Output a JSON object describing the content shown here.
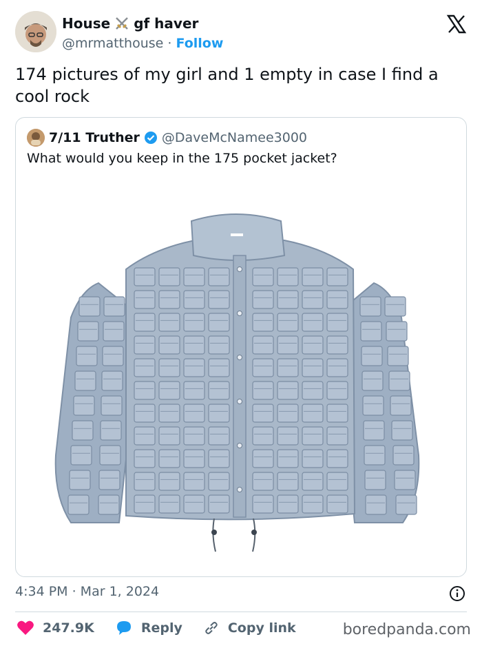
{
  "author": {
    "name_left": "House",
    "name_right": "gf haver",
    "name_icon": "crossed-swords-icon",
    "handle": "@mrmatthouse",
    "separator": "·",
    "follow_label": "Follow"
  },
  "tweet": {
    "text": "174 pictures of my girl and 1 empty in case I find a cool rock",
    "timestamp": "4:34 PM · Mar 1, 2024"
  },
  "quoted_tweet": {
    "name": "7/11 Truther",
    "handle": "@DaveMcNamee3000",
    "text": "What would you keep in the 175 pocket jacket?",
    "verified_icon": "verified-badge-icon",
    "image": "light-blue-jacket-with-many-pockets"
  },
  "actions": {
    "likes": "247.9K",
    "reply_label": "Reply",
    "copy_link_label": "Copy link"
  },
  "watermark": "boredpanda.com",
  "colors": {
    "accent": "#1d9bf0",
    "like": "#f91880",
    "jacket": "#a9b8c9",
    "text": "#0f1419",
    "muted": "#536471"
  }
}
